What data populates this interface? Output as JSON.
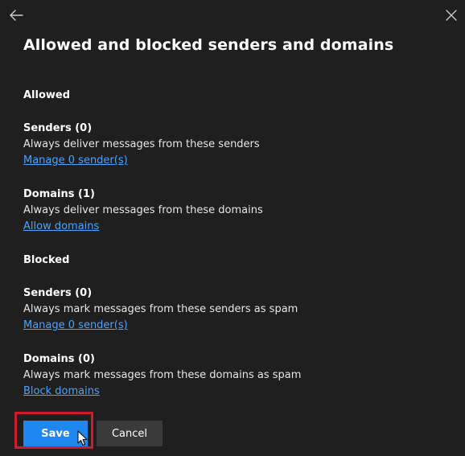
{
  "panel": {
    "title": "Allowed and blocked senders and domains",
    "back_icon": "arrow-left-icon",
    "close_icon": "close-icon"
  },
  "allowed": {
    "heading": "Allowed",
    "senders": {
      "title": "Senders (0)",
      "description": "Always deliver messages from these senders",
      "link": "Manage 0 sender(s)"
    },
    "domains": {
      "title": "Domains (1)",
      "description": "Always deliver messages from these domains",
      "link": "Allow domains"
    }
  },
  "blocked": {
    "heading": "Blocked",
    "senders": {
      "title": "Senders (0)",
      "description": "Always mark messages from these senders as spam",
      "link": "Manage 0 sender(s)"
    },
    "domains": {
      "title": "Domains (0)",
      "description": "Always mark messages from these domains as spam",
      "link": "Block domains"
    }
  },
  "footer": {
    "save_label": "Save",
    "cancel_label": "Cancel"
  },
  "colors": {
    "background": "#1f1f1f",
    "link": "#4aa3ff",
    "primary": "#1e88f0",
    "highlight": "#d11a2a"
  }
}
